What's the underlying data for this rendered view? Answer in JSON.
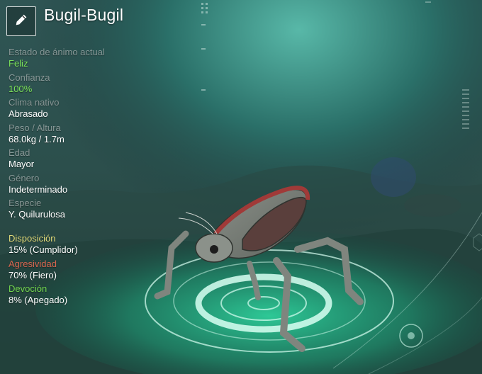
{
  "creature": {
    "name": "Bugil-Bugil"
  },
  "stats": [
    {
      "label": "Estado de ánimo actual",
      "value": "Feliz",
      "value_color": "green"
    },
    {
      "label": "Confianza",
      "value": "100%",
      "value_color": "green"
    },
    {
      "label": "Clima nativo",
      "value": "Abrasado",
      "value_color": "white"
    },
    {
      "label": "Peso / Altura",
      "value": "68.0kg / 1.7m",
      "value_color": "white"
    },
    {
      "label": "Edad",
      "value": "Mayor",
      "value_color": "white"
    },
    {
      "label": "Género",
      "value": "Indeterminado",
      "value_color": "white"
    },
    {
      "label": "Especie",
      "value": "Y. Quilurulosa",
      "value_color": "white"
    }
  ],
  "traits": [
    {
      "label": "Disposición",
      "value": "15% (Cumplidor)",
      "label_color": "#e3dd7c"
    },
    {
      "label": "Agresividad",
      "value": "70% (Fiero)",
      "label_color": "#d9664f"
    },
    {
      "label": "Devoción",
      "value": "8% (Apegado)",
      "label_color": "#74d84f"
    }
  ],
  "icons": {
    "edit": "pencil-icon"
  },
  "colors": {
    "accent_green": "#7ce35a",
    "platform_glow": "#3fe0b0"
  }
}
